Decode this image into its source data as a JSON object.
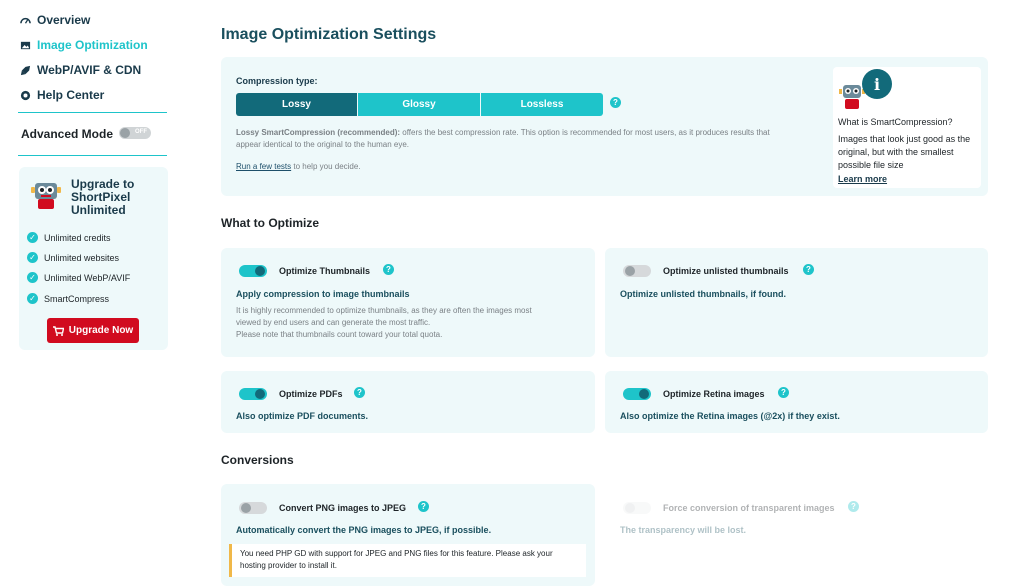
{
  "sidebar": {
    "nav": [
      {
        "label": "Overview",
        "icon": "dashboard-icon"
      },
      {
        "label": "Image Optimization",
        "icon": "image-icon"
      },
      {
        "label": "WebP/AVIF & CDN",
        "icon": "rocket-icon"
      },
      {
        "label": "Help Center",
        "icon": "lifebuoy-icon"
      }
    ],
    "advanced_mode_label": "Advanced Mode",
    "advanced_mode_toggle": "OFF",
    "upgrade": {
      "title": "Upgrade to ShortPixel Unlimited",
      "features": [
        "Unlimited credits",
        "Unlimited websites",
        "Unlimited WebP/AVIF",
        "SmartCompress"
      ],
      "button": "Upgrade Now"
    }
  },
  "main": {
    "title": "Image Optimization Settings",
    "compression": {
      "label": "Compression type:",
      "options": [
        "Lossy",
        "Glossy",
        "Lossless"
      ],
      "selected": "Lossy",
      "desc_bold": "Lossy SmartCompression (recommended):",
      "desc_line1": "offers the best compression rate. This option is recommended for most users, as it produces results that",
      "desc_line2": "appear identical to the original to the human eye.",
      "tests_link": "Run a few tests",
      "tests_rest": "to help you decide."
    },
    "info": {
      "title": "What is SmartCompression?",
      "body": "Images that look just good as the original, but with the smallest possible file size",
      "link": "Learn more"
    },
    "what_to_optimize": {
      "heading": "What to Optimize",
      "thumbnails": {
        "title": "Optimize Thumbnails",
        "sub": "Apply compression to image thumbnails",
        "desc1": "It is highly recommended to optimize thumbnails, as they are often the images most",
        "desc2": "viewed by end users and can generate the most traffic.",
        "desc3": "Please note that thumbnails count toward your total quota.",
        "enabled": true
      },
      "unlisted": {
        "title": "Optimize unlisted thumbnails",
        "sub": "Optimize unlisted thumbnails, if found.",
        "enabled": false
      },
      "pdfs": {
        "title": "Optimize PDFs",
        "sub": "Also optimize PDF documents.",
        "enabled": true
      },
      "retina": {
        "title": "Optimize Retina images",
        "sub": "Also optimize the Retina images (@2x) if they exist.",
        "enabled": true
      }
    },
    "conversions": {
      "heading": "Conversions",
      "png_to_jpeg": {
        "title": "Convert PNG images to JPEG",
        "sub": "Automatically convert the PNG images to JPEG, if possible.",
        "warning1": "You need PHP GD with support for JPEG and PNG files for this feature. Please ask your",
        "warning2": "hosting provider to install it.",
        "enabled": false
      },
      "force_transparent": {
        "title": "Force conversion of transparent images",
        "sub": "The transparency will be lost.",
        "enabled": false
      }
    }
  },
  "colors": {
    "accent": "#1ec4ca",
    "dark_teal": "#126a7a",
    "upgrade_red": "#d10b1f",
    "card_bg": "#eef9fa"
  }
}
